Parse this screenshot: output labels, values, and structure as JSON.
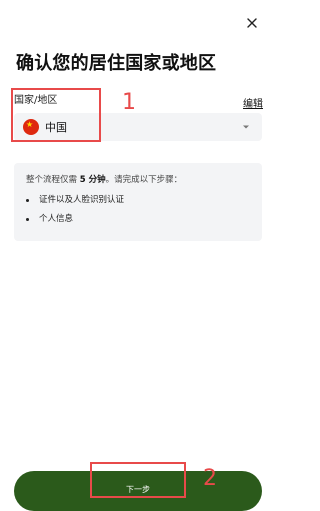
{
  "header": {
    "close_icon": "close-icon"
  },
  "page": {
    "title": "确认您的居住国家或地区"
  },
  "country": {
    "label": "国家/地区",
    "edit_label": "编辑",
    "selected_value": "中国",
    "flag_icon": "china-flag-icon",
    "chevron_icon": "chevron-down-icon"
  },
  "info": {
    "intro_prefix": "整个流程仅需",
    "intro_emphasis": "5 分钟",
    "intro_suffix": "。请完成以下步骤：",
    "steps": [
      "证件以及人脸识别认证",
      "个人信息"
    ]
  },
  "footer": {
    "next_label": "下一步"
  },
  "annotations": {
    "marker_1": "1",
    "marker_2": "2",
    "color": "#e84a4a"
  },
  "colors": {
    "primary_button": "#2b5a1b",
    "field_background": "#f3f4f6"
  }
}
